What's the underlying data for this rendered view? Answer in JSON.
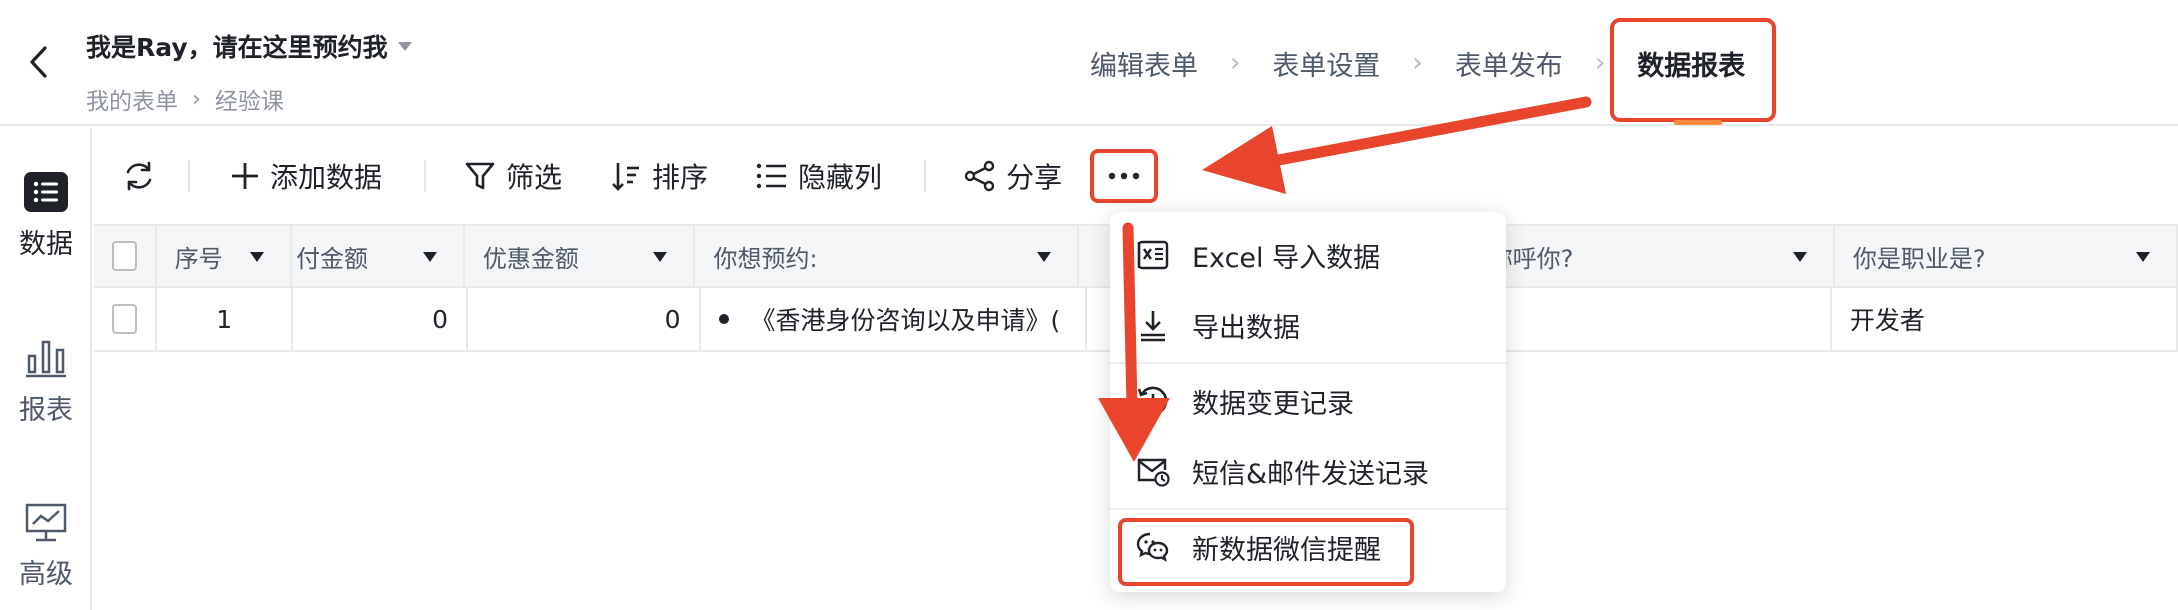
{
  "header": {
    "title": "我是Ray，请在这里预约我",
    "breadcrumb": [
      "我的表单",
      "经验课"
    ],
    "steps": [
      "编辑表单",
      "表单设置",
      "表单发布",
      "数据报表"
    ],
    "active_step": "数据报表"
  },
  "leftnav": {
    "items": [
      {
        "label": "数据",
        "icon": "list-icon",
        "active": true
      },
      {
        "label": "报表",
        "icon": "bar-chart-icon",
        "active": false
      },
      {
        "label": "高级",
        "icon": "presentation-icon",
        "active": false
      }
    ]
  },
  "toolbar": {
    "refresh_icon": "refresh-icon",
    "add_label": "添加数据",
    "filter_label": "筛选",
    "sort_label": "排序",
    "hide_columns_label": "隐藏列",
    "share_label": "分享",
    "more_icon": "more-icon"
  },
  "table": {
    "columns": [
      "序号",
      "付金额",
      "优惠金额",
      "你想预约:",
      "称呼你?",
      "你是职业是?"
    ],
    "row": {
      "index": "1",
      "paid": "0",
      "discount": "0",
      "appointment": "《香港身份咨询以及申请》(",
      "name": "",
      "job": "开发者"
    }
  },
  "menu": {
    "items": [
      {
        "label": "Excel 导入数据",
        "icon": "excel-import-icon"
      },
      {
        "label": "导出数据",
        "icon": "download-icon"
      },
      {
        "label": "数据变更记录",
        "icon": "history-icon"
      },
      {
        "label": "短信&邮件发送记录",
        "icon": "mail-clock-icon"
      },
      {
        "label": "新数据微信提醒",
        "icon": "wechat-icon"
      }
    ]
  },
  "colors": {
    "annotation_red": "#e8452c",
    "active_underline": "#ff8a3d"
  }
}
